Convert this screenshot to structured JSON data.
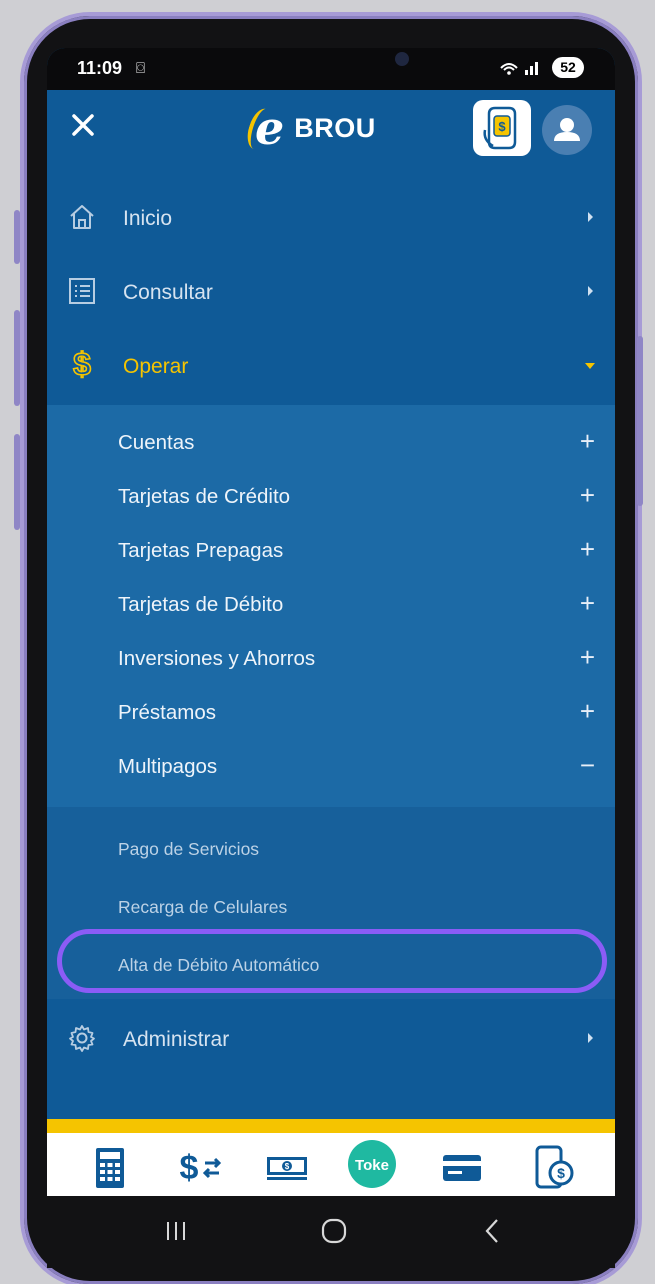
{
  "status_bar": {
    "time": "11:09",
    "battery": "52"
  },
  "header": {
    "brand_name": "BROU",
    "colors": {
      "primary": "#0f5a97",
      "accent": "#f5c400"
    }
  },
  "menu": {
    "items": [
      {
        "label": "Inicio",
        "icon": "home-icon"
      },
      {
        "label": "Consultar",
        "icon": "list-icon"
      },
      {
        "label": "Operar",
        "icon": "dollar-icon",
        "expanded": true
      },
      {
        "label": "Administrar",
        "icon": "gear-icon"
      }
    ],
    "operar_sub": [
      {
        "label": "Cuentas",
        "sign": "+"
      },
      {
        "label": "Tarjetas de Crédito",
        "sign": "+"
      },
      {
        "label": "Tarjetas Prepagas",
        "sign": "+"
      },
      {
        "label": "Tarjetas de Débito",
        "sign": "+"
      },
      {
        "label": "Inversiones y Ahorros",
        "sign": "+"
      },
      {
        "label": "Préstamos",
        "sign": "+"
      },
      {
        "label": "Multipagos",
        "sign": "−"
      }
    ],
    "multipagos_sub": [
      {
        "label": "Pago de Servicios"
      },
      {
        "label": "Recarga de Celulares"
      },
      {
        "label": "Alta de Débito Automático",
        "highlighted": true
      }
    ]
  },
  "bottom_bar": {
    "icons": [
      "calculator-icon",
      "exchange-icon",
      "cash-icon",
      "toke-icon",
      "card-icon",
      "phone-pay-icon"
    ],
    "toke_label": "Toke"
  }
}
